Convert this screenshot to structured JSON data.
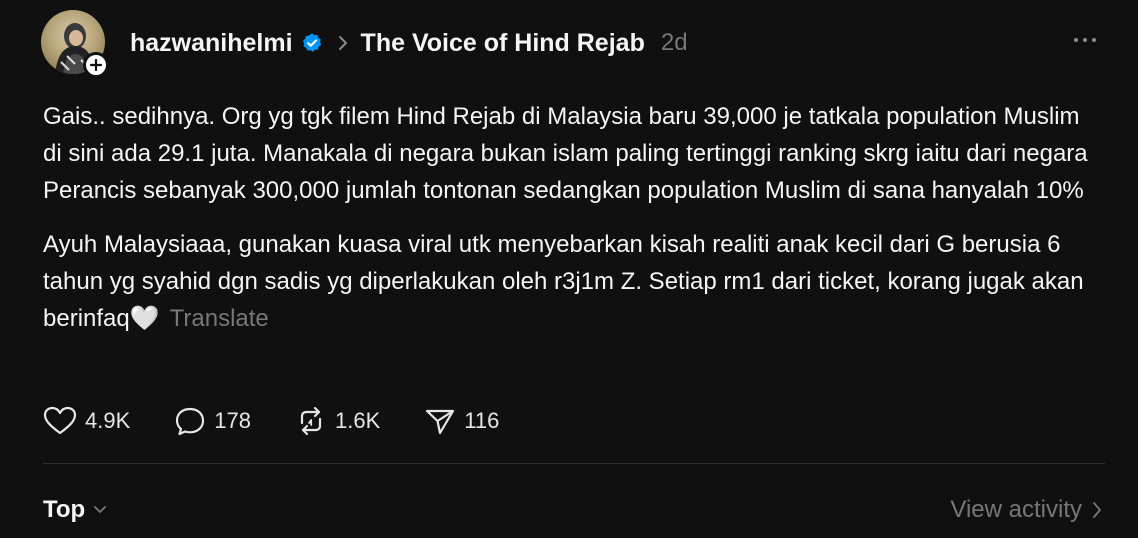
{
  "post": {
    "author": "hazwanihelmi",
    "community": "The Voice of Hind Rejab",
    "time": "2d",
    "paragraphs": [
      "Gais.. sedihnya. Org yg tgk filem Hind Rejab di Malaysia baru 39,000 je tatkala population Muslim di sini ada 29.1 juta. Manakala di negara bukan islam paling tertinggi ranking skrg iaitu dari negara Perancis sebanyak 300,000 jumlah tontonan sedangkan population Muslim di sana hanyalah 10%",
      "Ayuh Malaysiaaa, gunakan kuasa viral utk menyebarkan kisah realiti anak kecil dari G berusia 6 tahun yg syahid dgn sadis yg diperlakukan oleh r3j1m Z. Setiap rm1 dari ticket, korang jugak akan berinfaq🤍"
    ],
    "translate_label": "Translate"
  },
  "actions": {
    "likes": "4.9K",
    "replies": "178",
    "reposts": "1.6K",
    "shares": "116"
  },
  "footer": {
    "sort_label": "Top",
    "view_activity_label": "View activity"
  },
  "colors": {
    "background": "#101010",
    "text": "#f3f5f7",
    "muted": "#777777",
    "verified": "#0095f6"
  }
}
